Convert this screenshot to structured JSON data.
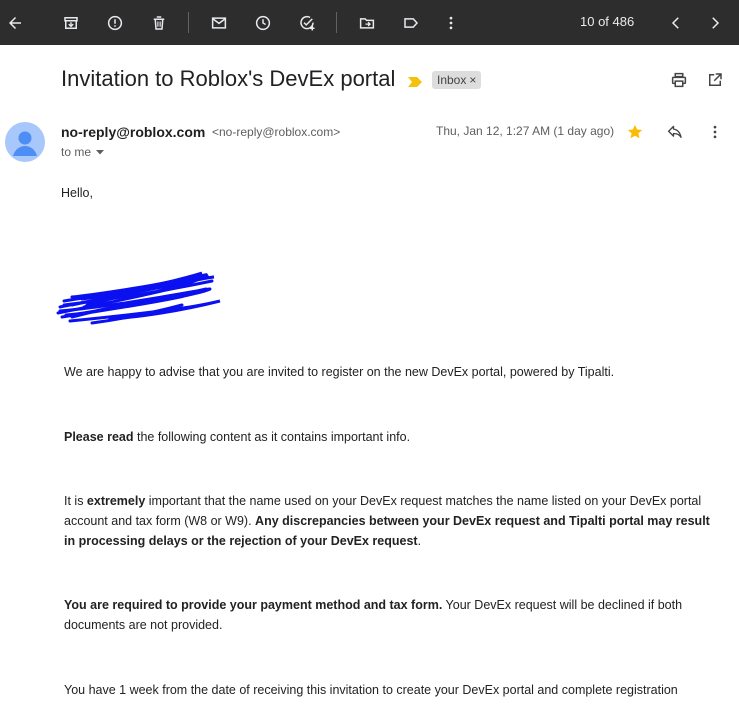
{
  "toolbar": {
    "pager_text": "10 of 486",
    "icons": [
      "back-arrow-icon",
      "archive-icon",
      "report-spam-icon",
      "delete-icon",
      "mark-unread-icon",
      "snooze-icon",
      "add-task-icon",
      "move-to-icon",
      "label-icon",
      "more-vert-icon",
      "chevron-left-icon",
      "chevron-right-icon"
    ]
  },
  "email": {
    "subject": "Invitation to Roblox's DevEx portal",
    "label_chip": "Inbox",
    "label_close": "×",
    "sender_name": "no-reply@roblox.com",
    "sender_email": "<no-reply@roblox.com>",
    "recipient": "to me",
    "date": "Thu, Jan 12, 1:27 AM (1 day ago)",
    "starred": true,
    "colors": {
      "star": "#fbbc04",
      "importance_marker": "#f4c20d",
      "avatar_bg": "#a8c7fa",
      "avatar_fg": "#4c8df6"
    }
  },
  "body": {
    "greeting": "Hello,",
    "p1": "We are happy to advise that you are invited to register on the new DevEx portal, powered by Tipalti.",
    "p2_bold": "Please read",
    "p2_rest": " the following content as it contains important info.",
    "p3_a": "It is ",
    "p3_b": "extremely",
    "p3_c": " important that the name used on your DevEx request matches the name listed on your DevEx portal account and tax form (W8 or W9). ",
    "p3_d": "Any discrepancies between your DevEx request and Tipalti portal may result in processing delays or the rejection of your DevEx request",
    "p3_e": ".",
    "p4_bold": "You are required to provide your payment method and tax form.",
    "p4_rest": " Your DevEx request will be declined if both documents are not provided.",
    "p5": "You have 1 week from the date of receiving this invitation to create your DevEx portal and complete registration"
  }
}
